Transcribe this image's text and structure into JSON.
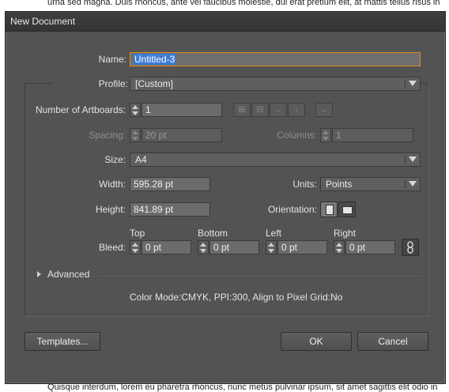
{
  "background": {
    "top_text": "urna sed magna. Duis rhoncus, ante vel faucibus molestie, dui erat pretium elit, at mattis tellus risus in",
    "bottom_text": "Quisque interdum, lorem eu pharetra rhoncus, nunc metus pulvinar ipsum, sit amet sagittis elit odio in"
  },
  "dialog": {
    "title": "New Document"
  },
  "name": {
    "label": "Name:",
    "value": "Untitled-3"
  },
  "profile": {
    "label": "Profile:",
    "value": "[Custom]"
  },
  "artboards": {
    "label": "Number of Artboards:",
    "value": "1"
  },
  "spacing": {
    "label": "Spacing:",
    "value": "20 pt"
  },
  "columns": {
    "label": "Columns:",
    "value": "1"
  },
  "size": {
    "label": "Size:",
    "value": "A4"
  },
  "width": {
    "label": "Width:",
    "value": "595.28 pt"
  },
  "units": {
    "label": "Units:",
    "value": "Points"
  },
  "height": {
    "label": "Height:",
    "value": "841.89 pt"
  },
  "orientation": {
    "label": "Orientation:",
    "selected": "portrait"
  },
  "bleed": {
    "label": "Bleed:",
    "top_label": "Top",
    "top_value": "0 pt",
    "bottom_label": "Bottom",
    "bottom_value": "0 pt",
    "left_label": "Left",
    "left_value": "0 pt",
    "right_label": "Right",
    "right_value": "0 pt"
  },
  "advanced": {
    "label": "Advanced"
  },
  "summary": "Color Mode:CMYK, PPI:300, Align to Pixel Grid:No",
  "buttons": {
    "templates": "Templates...",
    "ok": "OK",
    "cancel": "Cancel"
  },
  "colors": {
    "dialog_bg": "#535353",
    "focus_border": "#e08a1e",
    "selection": "#3b7bd4"
  }
}
